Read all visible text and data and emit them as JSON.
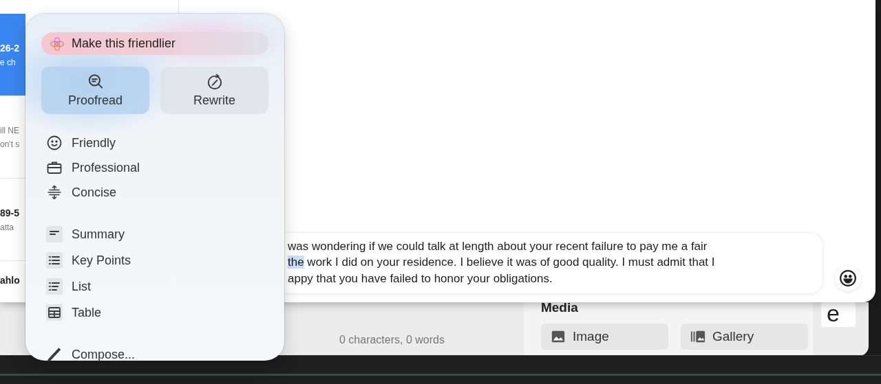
{
  "message_list": [
    {
      "title": "26-2",
      "lines": [
        "e ch"
      ],
      "selected": true
    },
    {
      "lines": [
        "ill NE",
        "on't s"
      ],
      "selected": false
    },
    {
      "title": "89-5",
      "lines": [
        "atta"
      ],
      "selected": false
    },
    {
      "title": "ahlo",
      "selected": false
    }
  ],
  "compose": {
    "lines": [
      [
        {
          "text": "was wondering if we could talk at length about your recent failure to pay me a fair",
          "selected": false
        }
      ],
      [
        {
          "text": "the",
          "selected": true
        },
        {
          "text": " work I did on your residence. I believe it was of good quality. I must admit that I",
          "selected": false
        }
      ],
      [
        {
          "text": "appy that you have failed to honor your obligations.",
          "selected": false
        }
      ]
    ]
  },
  "writing_tools": {
    "prompt_field": {
      "value": "Make this friendlier"
    },
    "actions": [
      {
        "label": "Proofread"
      },
      {
        "label": "Rewrite"
      }
    ],
    "sections": [
      [
        {
          "label": "Friendly"
        },
        {
          "label": "Professional"
        },
        {
          "label": "Concise"
        }
      ],
      [
        {
          "label": "Summary"
        },
        {
          "label": "Key Points"
        },
        {
          "label": "List"
        },
        {
          "label": "Table"
        }
      ],
      [
        {
          "label": "Compose..."
        }
      ]
    ]
  },
  "editor_footer": {
    "counter": "0 characters, 0 words"
  },
  "media": {
    "title": "Media",
    "buttons": [
      {
        "label": "Image"
      },
      {
        "label": "Gallery"
      }
    ]
  },
  "side_card": {
    "text": "e"
  }
}
